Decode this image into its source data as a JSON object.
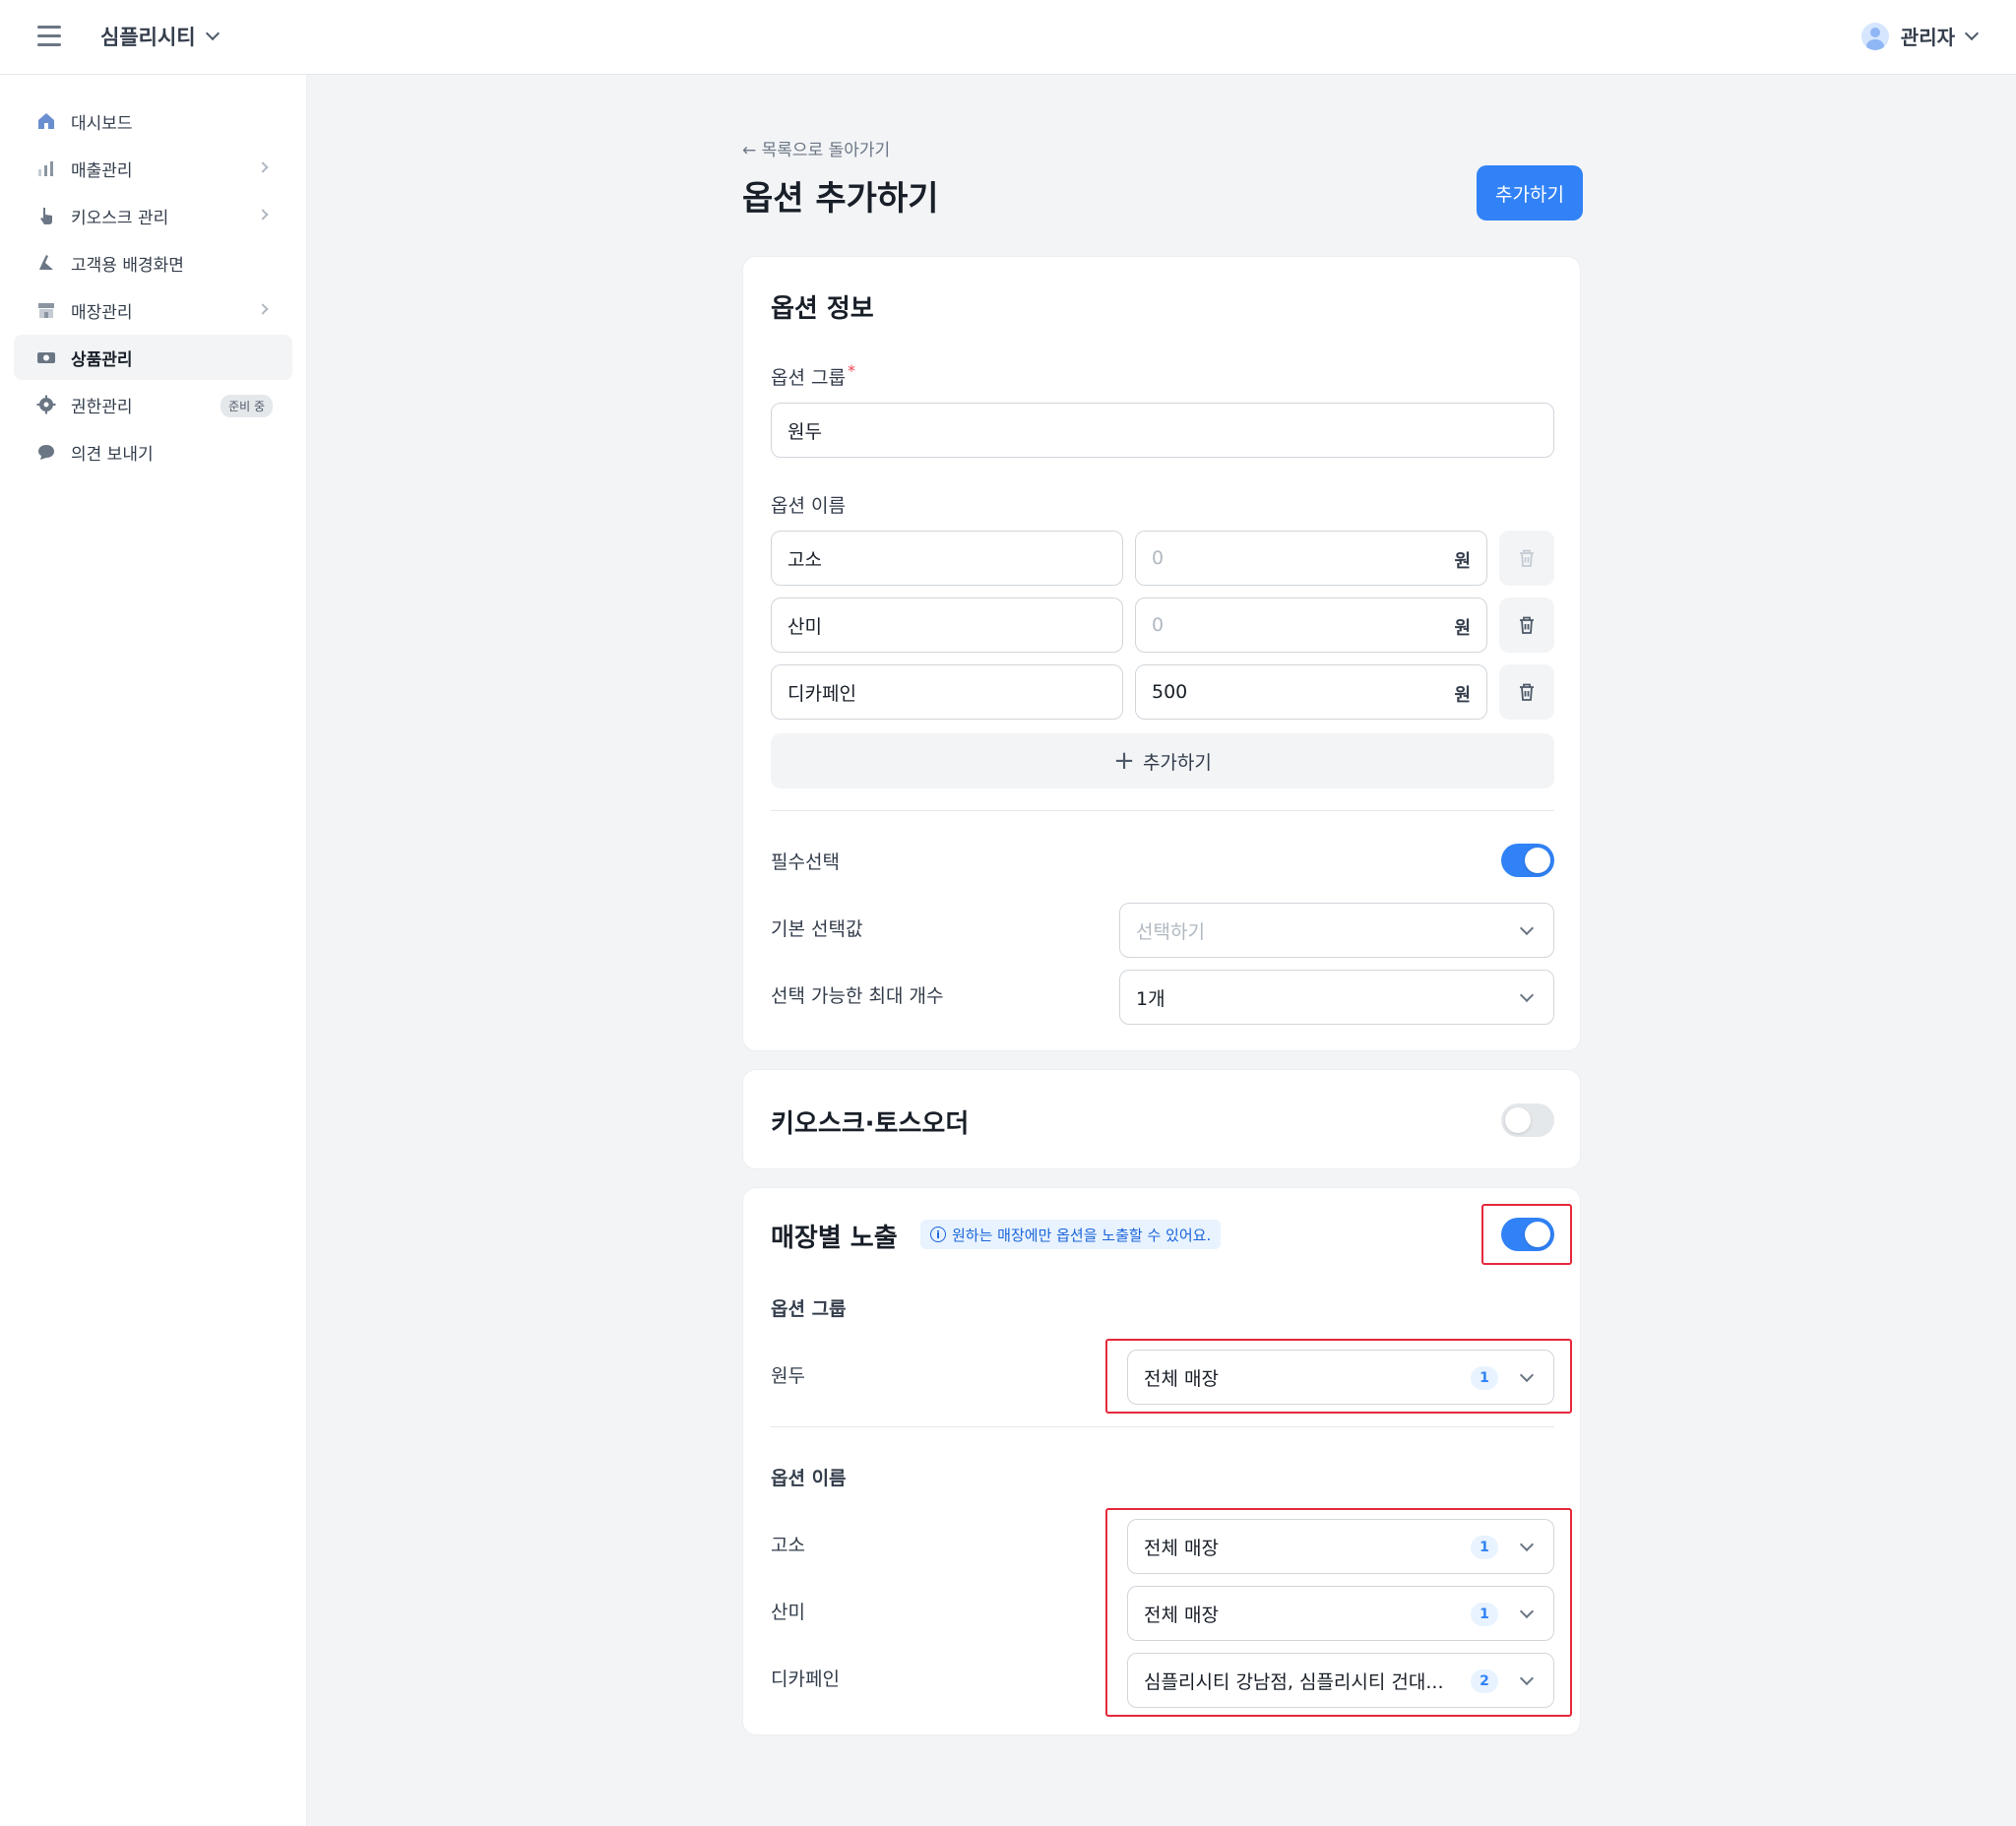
{
  "header": {
    "brand": "심플리시티",
    "user": "관리자"
  },
  "sidebar": {
    "items": [
      {
        "label": "대시보드",
        "icon": "home-icon"
      },
      {
        "label": "매출관리",
        "icon": "chart-icon"
      },
      {
        "label": "키오스크 관리",
        "icon": "hand-pointer-icon"
      },
      {
        "label": "고객용 배경화면",
        "icon": "brush-icon"
      },
      {
        "label": "매장관리",
        "icon": "store-icon"
      },
      {
        "label": "상품관리",
        "icon": "ticket-icon"
      },
      {
        "label": "권한관리",
        "icon": "gear-icon",
        "badge": "준비 중"
      },
      {
        "label": "의견 보내기",
        "icon": "chat-bubble-icon"
      }
    ],
    "active_index": 5
  },
  "page": {
    "back_link": "← 목록으로 돌아가기",
    "title": "옵션 추가하기",
    "submit_label": "추가하기"
  },
  "option_info": {
    "title": "옵션 정보",
    "group_label": "옵션 그룹",
    "group_required_mark": "*",
    "group_value": "원두",
    "names_label": "옵션 이름",
    "options": [
      {
        "name": "고소",
        "price": "0",
        "price_is_placeholder": true,
        "unit": "원"
      },
      {
        "name": "산미",
        "price": "0",
        "price_is_placeholder": true,
        "unit": "원"
      },
      {
        "name": "디카페인",
        "price": "500",
        "price_is_placeholder": false,
        "unit": "원"
      }
    ],
    "add_label": "추가하기",
    "required_label": "필수선택",
    "required_on": true,
    "default_label": "기본 선택값",
    "default_placeholder": "선택하기",
    "max_label": "선택 가능한 최대 개수",
    "max_value": "1개"
  },
  "kiosk": {
    "title": "키오스크·토스오더",
    "enabled": false
  },
  "store_exposure": {
    "title": "매장별 노출",
    "info": "원하는 매장에만 옵션을 노출할 수 있어요.",
    "enabled": true,
    "group_section_label": "옵션 그룹",
    "group_rows": [
      {
        "label": "원두",
        "value": "전체 매장",
        "count": "1"
      }
    ],
    "names_section_label": "옵션 이름",
    "name_rows": [
      {
        "label": "고소",
        "value": "전체 매장",
        "count": "1"
      },
      {
        "label": "산미",
        "value": "전체 매장",
        "count": "1"
      },
      {
        "label": "디카페인",
        "value": "심플리시티 강남점, 심플리시티 건대...",
        "count": "2"
      }
    ]
  },
  "colors": {
    "accent": "#3182f6",
    "highlight": "#e5283c",
    "background": "#f2f4f6"
  }
}
